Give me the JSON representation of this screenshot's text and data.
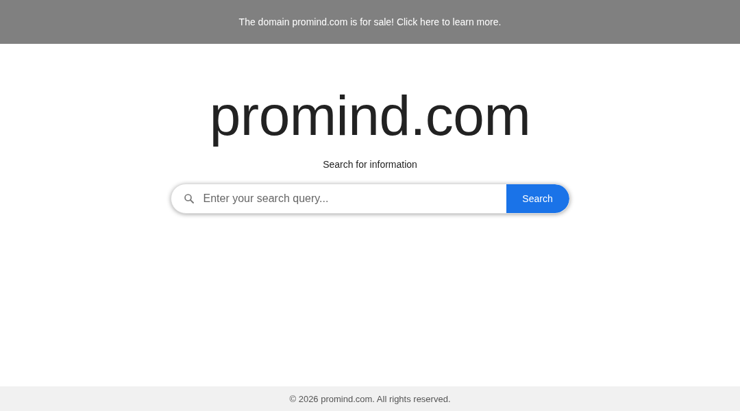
{
  "banner": {
    "text": "The domain promind.com is for sale! Click here to learn more."
  },
  "title": "promind.com",
  "subtitle": "Search for information",
  "search": {
    "placeholder": "Enter your search query...",
    "button": "Search"
  },
  "footer": "© 2026 promind.com. All rights reserved."
}
